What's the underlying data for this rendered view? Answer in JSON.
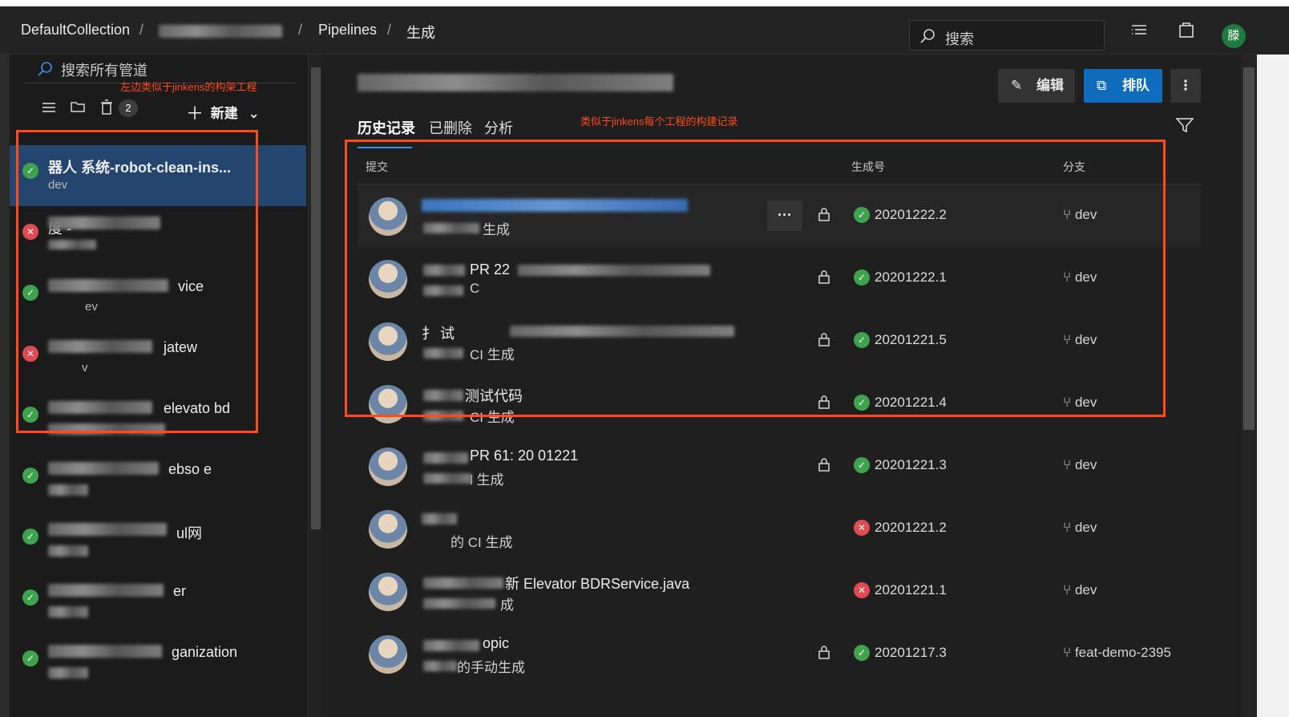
{
  "breadcrumb": {
    "collection": "DefaultCollection",
    "pipelines": "Pipelines",
    "current": "生成"
  },
  "topbar": {
    "search_placeholder": "搜索",
    "user_initial": "滕"
  },
  "left": {
    "search_placeholder": "搜索所有管道",
    "annotation": "左边类似于jinkens的构架工程",
    "badge_count": "2",
    "new_label": "新建",
    "pipelines": [
      {
        "name": "器人 系统-robot-clean-ins...",
        "branch": "dev",
        "status": "ok",
        "selected": true
      },
      {
        "name": "度 -",
        "branch": "",
        "status": "fail"
      },
      {
        "name": "vice",
        "branch": "ev",
        "status": "ok"
      },
      {
        "name": "jatew",
        "branch": "v",
        "status": "fail"
      },
      {
        "name": "elevato bd",
        "branch": "",
        "status": "ok"
      },
      {
        "name": "ebso e",
        "branch": "",
        "status": "ok"
      },
      {
        "name": "ul网",
        "branch": "",
        "status": "ok"
      },
      {
        "name": "er",
        "branch": "",
        "status": "ok"
      },
      {
        "name": "ganization",
        "branch": "",
        "status": "ok"
      }
    ]
  },
  "main": {
    "buttons": {
      "edit": "编辑",
      "queue": "排队",
      "more": "⋮"
    },
    "tabs": [
      "历史记录",
      "已删除",
      "分析"
    ],
    "annotation": "类似于jinkens每个工程的构建记录",
    "columns": {
      "commit": "提交",
      "build_number": "生成号",
      "branch": "分支"
    },
    "builds": [
      {
        "title": "",
        "sub": "生成",
        "number": "20201222.2",
        "status": "ok",
        "branch": "dev",
        "locked": true,
        "highlight": true
      },
      {
        "title": "PR 22",
        "sub": "C",
        "number": "20201222.1",
        "status": "ok",
        "branch": "dev",
        "locked": true
      },
      {
        "title": "扌 试",
        "sub": "CI 生成",
        "number": "20201221.5",
        "status": "ok",
        "branch": "dev",
        "locked": true
      },
      {
        "title": "测试代码",
        "sub": "CI 生成",
        "number": "20201221.4",
        "status": "ok",
        "branch": "dev",
        "locked": true
      },
      {
        "title": "PR 61: 20 01221",
        "sub": "l 生成",
        "number": "20201221.3",
        "status": "ok",
        "branch": "dev",
        "locked": true
      },
      {
        "title": "",
        "sub": "的 CI 生成",
        "number": "20201221.2",
        "status": "fail",
        "branch": "dev",
        "locked": false
      },
      {
        "title": "新 Elevator BDRService.java",
        "sub": "成",
        "number": "20201221.1",
        "status": "fail",
        "branch": "dev",
        "locked": false
      },
      {
        "title": "opic",
        "sub": "的手动生成",
        "number": "20201217.3",
        "status": "ok",
        "branch": "feat-demo-2395",
        "locked": true
      }
    ]
  },
  "colors": {
    "accent": "#0f6cbd",
    "success": "#3fa34d",
    "failure": "#e04a53",
    "annotation": "#ff4a1a",
    "selected_row": "#24466e"
  }
}
